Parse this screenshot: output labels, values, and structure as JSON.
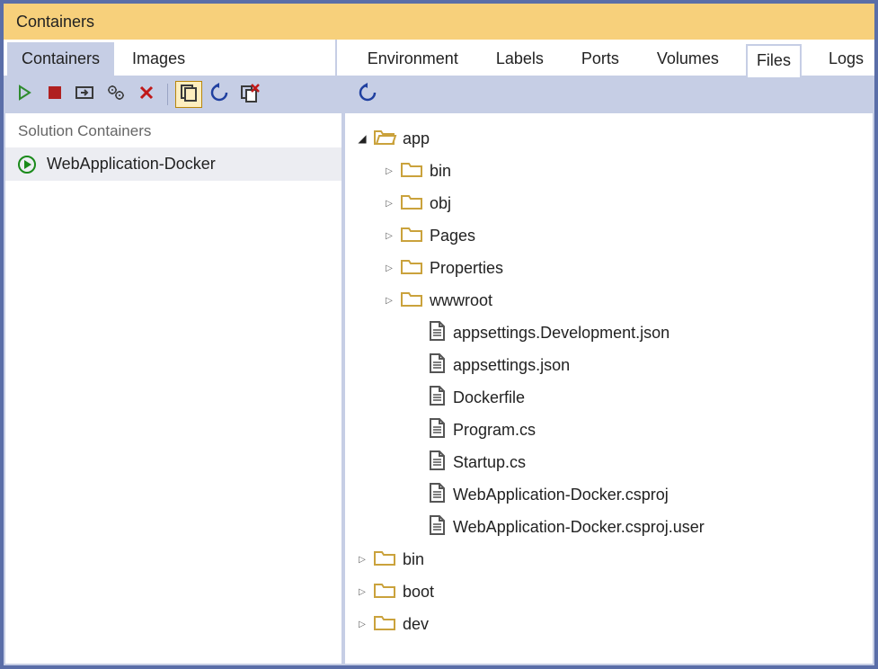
{
  "window": {
    "title": "Containers"
  },
  "leftTabs": [
    {
      "label": "Containers",
      "active": true
    },
    {
      "label": "Images",
      "active": false
    }
  ],
  "rightTabs": [
    {
      "label": "Environment",
      "active": false
    },
    {
      "label": "Labels",
      "active": false
    },
    {
      "label": "Ports",
      "active": false
    },
    {
      "label": "Volumes",
      "active": false
    },
    {
      "label": "Files",
      "active": true
    },
    {
      "label": "Logs",
      "active": false
    }
  ],
  "leftToolbar": {
    "buttons": [
      "start",
      "stop",
      "attach",
      "settings",
      "delete",
      "copy",
      "refresh",
      "prune"
    ],
    "selected": "copy"
  },
  "rightToolbar": {
    "buttons": [
      "refresh"
    ]
  },
  "leftSection": {
    "header": "Solution Containers"
  },
  "containers": [
    {
      "name": "WebApplication-Docker",
      "state": "running"
    }
  ],
  "fileTree": [
    {
      "depth": 1,
      "type": "folder",
      "open": true,
      "name": "app"
    },
    {
      "depth": 2,
      "type": "folder",
      "open": false,
      "name": "bin"
    },
    {
      "depth": 2,
      "type": "folder",
      "open": false,
      "name": "obj"
    },
    {
      "depth": 2,
      "type": "folder",
      "open": false,
      "name": "Pages"
    },
    {
      "depth": 2,
      "type": "folder",
      "open": false,
      "name": "Properties"
    },
    {
      "depth": 2,
      "type": "folder",
      "open": false,
      "name": "wwwroot"
    },
    {
      "depth": 3,
      "type": "file",
      "name": "appsettings.Development.json"
    },
    {
      "depth": 3,
      "type": "file",
      "name": "appsettings.json"
    },
    {
      "depth": 3,
      "type": "file",
      "name": "Dockerfile"
    },
    {
      "depth": 3,
      "type": "file",
      "name": "Program.cs"
    },
    {
      "depth": 3,
      "type": "file",
      "name": "Startup.cs"
    },
    {
      "depth": 3,
      "type": "file",
      "name": "WebApplication-Docker.csproj"
    },
    {
      "depth": 3,
      "type": "file",
      "name": "WebApplication-Docker.csproj.user"
    },
    {
      "depth": 1,
      "type": "folder",
      "open": false,
      "name": "bin"
    },
    {
      "depth": 1,
      "type": "folder",
      "open": false,
      "name": "boot"
    },
    {
      "depth": 1,
      "type": "folder",
      "open": false,
      "name": "dev"
    }
  ],
  "colors": {
    "accent": "#c6cee5",
    "titlebar": "#f7d07b",
    "folder": "#caa23c",
    "icon": "#3a3a3a"
  }
}
